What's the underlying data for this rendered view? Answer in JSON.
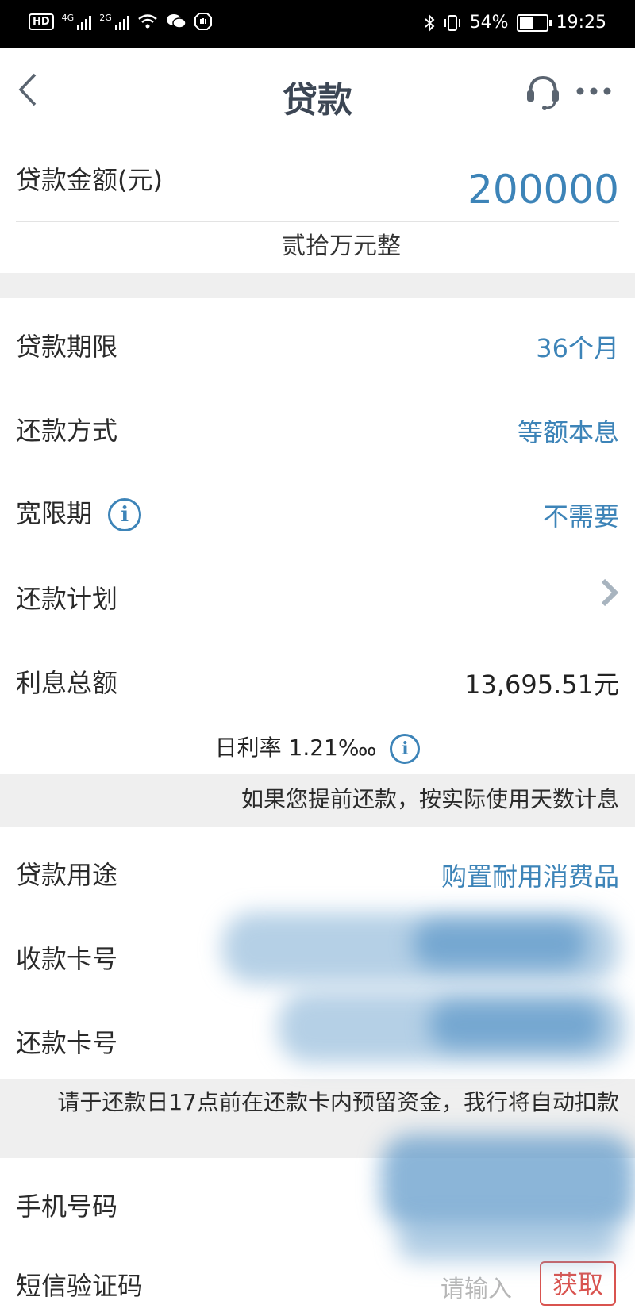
{
  "status_bar": {
    "left_badge": "HD",
    "sig1": "4G",
    "sig2": "2G",
    "battery": "54%",
    "time": "19:25",
    "battery_level": 0.54
  },
  "header": {
    "title": "贷款",
    "icons": {
      "back": "chevron-left-icon",
      "service": "headset-icon",
      "more": "more-dots-icon"
    }
  },
  "loan": {
    "amount_label": "贷款金额(元)",
    "amount_value": "200000",
    "amount_words": "贰拾万元整",
    "term_label": "贷款期限",
    "term_value": "36个月",
    "method_label": "还款方式",
    "method_value": "等额本息",
    "grace_label": "宽限期",
    "grace_value": "不需要",
    "plan_label": "还款计划",
    "interest_label": "利息总额",
    "interest_value": "13,695.51元",
    "rate_text": "日利率 1.21‱",
    "prepay_notice": "如果您提前还款，按实际使用天数计息",
    "purpose_label": "贷款用途",
    "purpose_value": "购置耐用消费品",
    "receive_card_label": "收款卡号",
    "repay_card_label": "还款卡号",
    "reserve_notice": "请于还款日17点前在还款卡内预留资金，我行将自动扣款",
    "phone_label": "手机号码",
    "sms_label": "短信验证码",
    "sms_placeholder": "请输入",
    "sms_button": "获取"
  },
  "colors": {
    "accent": "#3d84b8",
    "danger": "#d9534f",
    "band": "#efefef"
  }
}
